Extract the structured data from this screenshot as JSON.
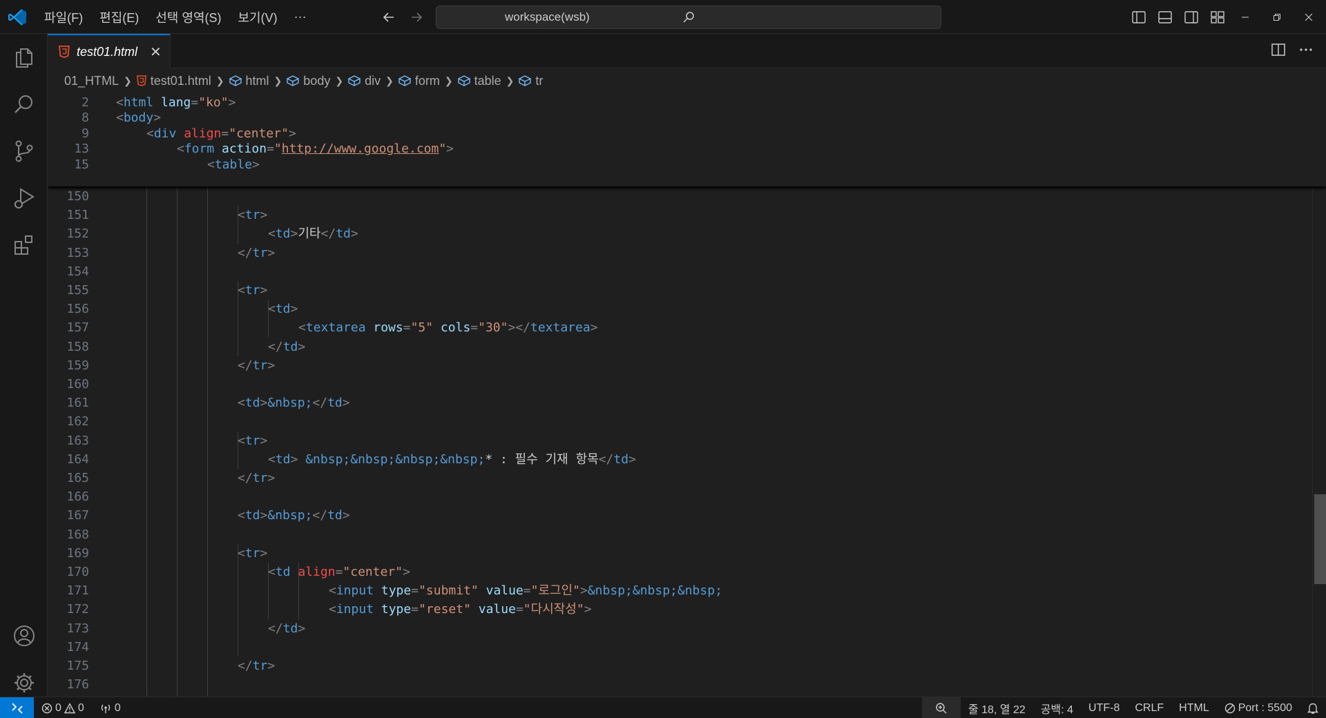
{
  "menu": [
    "파일(F)",
    "편집(E)",
    "선택 영역(S)",
    "보기(V)",
    "···"
  ],
  "search": {
    "text": "workspace(wsb)"
  },
  "tab": {
    "label": "test01.html",
    "close": "✕"
  },
  "breadcrumb": [
    "01_HTML",
    "test01.html",
    "html",
    "body",
    "div",
    "form",
    "table",
    "tr"
  ],
  "colors": {
    "accent": "#0078d4",
    "html_icon": "#e44d26",
    "editor_bg": "#1f1f1f"
  },
  "sticky": [
    {
      "ln": "2",
      "indent": 0,
      "tokens": [
        [
          "punc",
          "<"
        ],
        [
          "tag",
          "html"
        ],
        [
          "attr",
          " lang"
        ],
        [
          "punc",
          "="
        ],
        [
          "str",
          "\"ko\""
        ],
        [
          "punc",
          ">"
        ]
      ]
    },
    {
      "ln": "8",
      "indent": 0,
      "tokens": [
        [
          "punc",
          "<"
        ],
        [
          "tag",
          "body"
        ],
        [
          "punc",
          ">"
        ]
      ]
    },
    {
      "ln": "9",
      "indent": 1,
      "tokens": [
        [
          "punc",
          "<"
        ],
        [
          "tag",
          "div"
        ],
        [
          "attr-red",
          " align"
        ],
        [
          "punc",
          "="
        ],
        [
          "str",
          "\"center\""
        ],
        [
          "punc",
          ">"
        ]
      ]
    },
    {
      "ln": "13",
      "indent": 2,
      "tokens": [
        [
          "punc",
          "<"
        ],
        [
          "tag",
          "form"
        ],
        [
          "attr",
          " action"
        ],
        [
          "punc",
          "="
        ],
        [
          "str",
          "\""
        ],
        [
          "url",
          "http://www.google.com"
        ],
        [
          "str",
          "\""
        ],
        [
          "punc",
          ">"
        ]
      ]
    },
    {
      "ln": "15",
      "indent": 3,
      "tokens": [
        [
          "punc",
          "<"
        ],
        [
          "tag",
          "table"
        ],
        [
          "punc",
          ">"
        ]
      ]
    }
  ],
  "lines": [
    {
      "ln": "150",
      "indent": 0,
      "tokens": []
    },
    {
      "ln": "151",
      "indent": 4,
      "tokens": [
        [
          "punc",
          "<"
        ],
        [
          "tag",
          "tr"
        ],
        [
          "punc",
          ">"
        ]
      ]
    },
    {
      "ln": "152",
      "indent": 5,
      "tokens": [
        [
          "punc",
          "<"
        ],
        [
          "tag",
          "td"
        ],
        [
          "punc",
          ">"
        ],
        [
          "text",
          "기타"
        ],
        [
          "punc",
          "</"
        ],
        [
          "tag",
          "td"
        ],
        [
          "punc",
          ">"
        ]
      ]
    },
    {
      "ln": "153",
      "indent": 4,
      "tokens": [
        [
          "punc",
          "</"
        ],
        [
          "tag",
          "tr"
        ],
        [
          "punc",
          ">"
        ]
      ]
    },
    {
      "ln": "154",
      "indent": 0,
      "tokens": []
    },
    {
      "ln": "155",
      "indent": 4,
      "tokens": [
        [
          "punc",
          "<"
        ],
        [
          "tag",
          "tr"
        ],
        [
          "punc",
          ">"
        ]
      ]
    },
    {
      "ln": "156",
      "indent": 5,
      "tokens": [
        [
          "punc",
          "<"
        ],
        [
          "tag",
          "td"
        ],
        [
          "punc",
          ">"
        ]
      ]
    },
    {
      "ln": "157",
      "indent": 6,
      "tokens": [
        [
          "punc",
          "<"
        ],
        [
          "tag",
          "textarea"
        ],
        [
          "attr",
          " rows"
        ],
        [
          "punc",
          "="
        ],
        [
          "str",
          "\"5\""
        ],
        [
          "attr",
          " cols"
        ],
        [
          "punc",
          "="
        ],
        [
          "str",
          "\"30\""
        ],
        [
          "punc",
          "></"
        ],
        [
          "tag",
          "textarea"
        ],
        [
          "punc",
          ">"
        ]
      ]
    },
    {
      "ln": "158",
      "indent": 5,
      "tokens": [
        [
          "punc",
          "</"
        ],
        [
          "tag",
          "td"
        ],
        [
          "punc",
          ">"
        ]
      ]
    },
    {
      "ln": "159",
      "indent": 4,
      "tokens": [
        [
          "punc",
          "</"
        ],
        [
          "tag",
          "tr"
        ],
        [
          "punc",
          ">"
        ]
      ]
    },
    {
      "ln": "160",
      "indent": 0,
      "tokens": []
    },
    {
      "ln": "161",
      "indent": 4,
      "tokens": [
        [
          "punc",
          "<"
        ],
        [
          "tag",
          "td"
        ],
        [
          "punc",
          ">"
        ],
        [
          "ent",
          "&nbsp;"
        ],
        [
          "punc",
          "</"
        ],
        [
          "tag",
          "td"
        ],
        [
          "punc",
          ">"
        ]
      ]
    },
    {
      "ln": "162",
      "indent": 0,
      "tokens": []
    },
    {
      "ln": "163",
      "indent": 4,
      "tokens": [
        [
          "punc",
          "<"
        ],
        [
          "tag",
          "tr"
        ],
        [
          "punc",
          ">"
        ]
      ]
    },
    {
      "ln": "164",
      "indent": 5,
      "tokens": [
        [
          "punc",
          "<"
        ],
        [
          "tag",
          "td"
        ],
        [
          "punc",
          ">"
        ],
        [
          "text",
          " "
        ],
        [
          "ent",
          "&nbsp;&nbsp;&nbsp;&nbsp;"
        ],
        [
          "text",
          "* : 필수 기재 항목"
        ],
        [
          "punc",
          "</"
        ],
        [
          "tag",
          "td"
        ],
        [
          "punc",
          ">"
        ]
      ]
    },
    {
      "ln": "165",
      "indent": 4,
      "tokens": [
        [
          "punc",
          "</"
        ],
        [
          "tag",
          "tr"
        ],
        [
          "punc",
          ">"
        ]
      ]
    },
    {
      "ln": "166",
      "indent": 0,
      "tokens": []
    },
    {
      "ln": "167",
      "indent": 4,
      "tokens": [
        [
          "punc",
          "<"
        ],
        [
          "tag",
          "td"
        ],
        [
          "punc",
          ">"
        ],
        [
          "ent",
          "&nbsp;"
        ],
        [
          "punc",
          "</"
        ],
        [
          "tag",
          "td"
        ],
        [
          "punc",
          ">"
        ]
      ]
    },
    {
      "ln": "168",
      "indent": 0,
      "tokens": []
    },
    {
      "ln": "169",
      "indent": 4,
      "tokens": [
        [
          "punc",
          "<"
        ],
        [
          "tag",
          "tr"
        ],
        [
          "punc",
          ">"
        ]
      ]
    },
    {
      "ln": "170",
      "indent": 5,
      "tokens": [
        [
          "punc",
          "<"
        ],
        [
          "tag",
          "td"
        ],
        [
          "attr-red",
          " align"
        ],
        [
          "punc",
          "="
        ],
        [
          "str",
          "\"center\""
        ],
        [
          "punc",
          ">"
        ]
      ]
    },
    {
      "ln": "171",
      "indent": 7,
      "tokens": [
        [
          "punc",
          "<"
        ],
        [
          "tag",
          "input"
        ],
        [
          "attr",
          " type"
        ],
        [
          "punc",
          "="
        ],
        [
          "str",
          "\"submit\""
        ],
        [
          "attr",
          " value"
        ],
        [
          "punc",
          "="
        ],
        [
          "str",
          "\"로그인\""
        ],
        [
          "punc",
          ">"
        ],
        [
          "ent",
          "&nbsp;&nbsp;&nbsp;"
        ]
      ]
    },
    {
      "ln": "172",
      "indent": 7,
      "tokens": [
        [
          "punc",
          "<"
        ],
        [
          "tag",
          "input"
        ],
        [
          "attr",
          " type"
        ],
        [
          "punc",
          "="
        ],
        [
          "str",
          "\"reset\""
        ],
        [
          "attr",
          " value"
        ],
        [
          "punc",
          "="
        ],
        [
          "str",
          "\"다시작성\""
        ],
        [
          "punc",
          ">"
        ]
      ]
    },
    {
      "ln": "173",
      "indent": 5,
      "tokens": [
        [
          "punc",
          "</"
        ],
        [
          "tag",
          "td"
        ],
        [
          "punc",
          ">"
        ]
      ]
    },
    {
      "ln": "174",
      "indent": 0,
      "tokens": []
    },
    {
      "ln": "175",
      "indent": 4,
      "tokens": [
        [
          "punc",
          "</"
        ],
        [
          "tag",
          "tr"
        ],
        [
          "punc",
          ">"
        ]
      ]
    },
    {
      "ln": "176",
      "indent": 0,
      "tokens": []
    }
  ],
  "status": {
    "errors": "0",
    "warnings": "0",
    "ports": "0",
    "position": "줄 18, 열 22",
    "spaces": "공백: 4",
    "encoding": "UTF-8",
    "eol": "CRLF",
    "language": "HTML",
    "port": "Port : 5500"
  }
}
